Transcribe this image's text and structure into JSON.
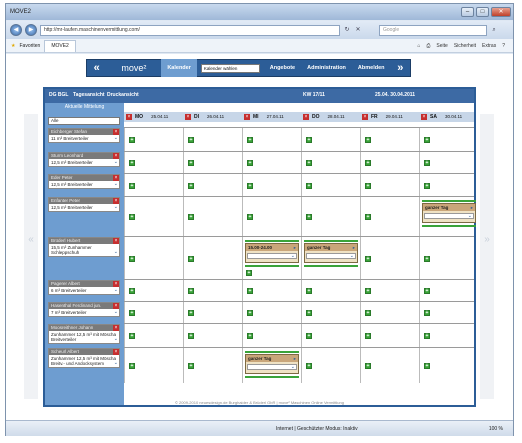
{
  "browser": {
    "title": "MOVE2",
    "url": "http://mr-laufen.maschinenvermittlung.com/",
    "search_placeholder": "Google",
    "favorites_label": "Favoriten",
    "tab_label": "MOVE2",
    "menu": [
      "Seite",
      "Sicherheit",
      "Extras"
    ],
    "status_zone": "Internet | Geschützter Modus: Inaktiv",
    "zoom": "100 %"
  },
  "app": {
    "logo": "move²",
    "nav": [
      "Kalender",
      "Kalender wählen",
      "Angebote",
      "Administration",
      "Abmelden"
    ],
    "header": {
      "org": "DG BGL",
      "view_day": "Tagesansicht",
      "print_view": "Druckansicht",
      "week": "KW 17/11",
      "range": "25.04.  30.04.2011"
    },
    "sub_header": "Aktuelle Mittelung",
    "filter_value": "Alle",
    "days": [
      {
        "abbr": "MO",
        "date": "25.04.11"
      },
      {
        "abbr": "DI",
        "date": "26.04.11"
      },
      {
        "abbr": "MI",
        "date": "27.04.11"
      },
      {
        "abbr": "DO",
        "date": "28.04.11"
      },
      {
        "abbr": "FR",
        "date": "29.04.11"
      },
      {
        "abbr": "SA",
        "date": "30.04.11"
      }
    ],
    "people": [
      {
        "name": "Eichberger Stefan",
        "machine": "11 m³ Breitverteiler"
      },
      {
        "name": "Sturm Leonhard",
        "machine": "12,5 m³ Breitverteiler"
      },
      {
        "name": "Eder Peter",
        "machine": "12,5 m³ Breitverteiler"
      },
      {
        "name": "Enfanter Peter",
        "machine": "12,5 m³ Breitverteiler"
      },
      {
        "name": "Brüderl Hubert",
        "machine": "15,5 m³ Zunhammer Schleppschuh"
      },
      {
        "name": "Pagerer Albert",
        "machine": "6 m³ Breitverteiler"
      },
      {
        "name": "Hasenthal Ferdinand jun.",
        "machine": "7 m³ Breitverteiler"
      },
      {
        "name": "Moosreithner Johann",
        "machine": "Zunhammer 12,5 m³ mit Möscha Breitverteiler"
      },
      {
        "name": "Scheurl Albert",
        "machine": "Zunhammer 12,5 m³ mit Möscha Breitv.- und Andocksystem"
      }
    ],
    "bookings": {
      "full_day": "ganzer Tag",
      "time_slot": "15.00-24.00"
    },
    "footer": "© 2009-2010 neuesdesign.de Burghaider & Brüderl GbR | move² Maschinen Online Vermittlung"
  }
}
